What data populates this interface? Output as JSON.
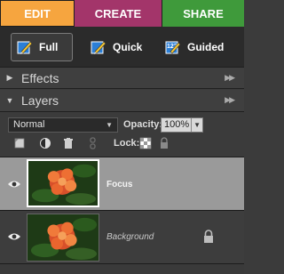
{
  "tabs": {
    "edit": "EDIT",
    "create": "CREATE",
    "share": "SHARE"
  },
  "modes": {
    "full": "Full",
    "quick": "Quick",
    "guided": "Guided"
  },
  "panels": {
    "effects": "Effects",
    "layers": "Layers"
  },
  "layers_panel": {
    "blend_mode": "Normal",
    "opacity_label": "Opacity:",
    "opacity_value": "100%",
    "lock_label": "Lock:"
  },
  "layers": [
    {
      "name": "Focus",
      "selected": true,
      "locked": false
    },
    {
      "name": "Background",
      "selected": false,
      "locked": true
    }
  ],
  "colors": {
    "edit_tab": "#f6a53f",
    "create_tab": "#a3356a",
    "share_tab": "#3f9a3b",
    "selected_layer": "#9a9a9a"
  }
}
